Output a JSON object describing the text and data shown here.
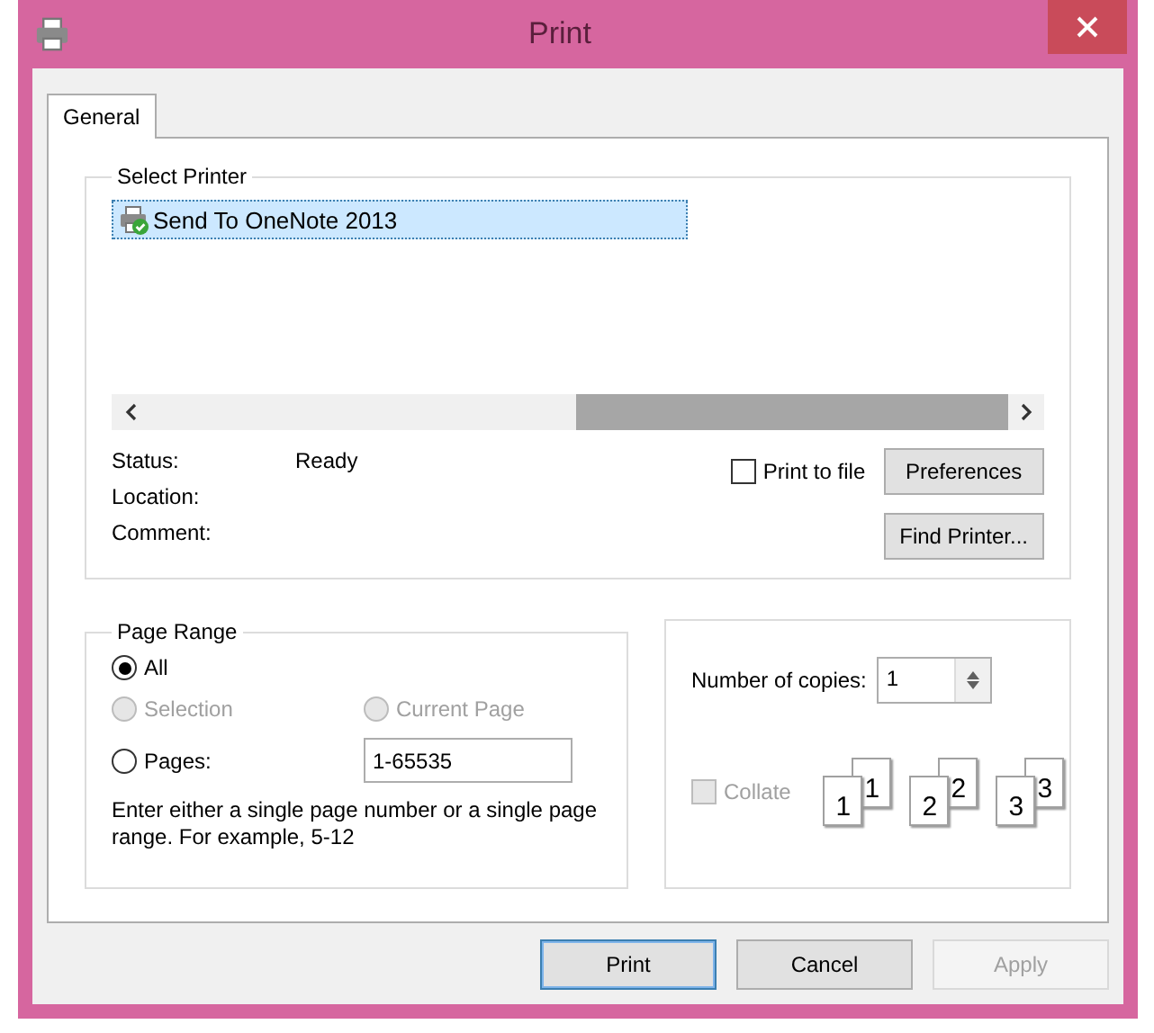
{
  "window": {
    "title": "Print"
  },
  "tabs": [
    {
      "label": "General",
      "selected": true
    }
  ],
  "select_printer": {
    "title": "Select Printer",
    "printers": [
      {
        "name": "Send To OneNote 2013",
        "selected": true
      }
    ],
    "info": [
      {
        "label": "Status:",
        "value": "Ready"
      },
      {
        "label": "Location:"
      },
      {
        "label": "Comment:"
      }
    ],
    "print_to_file": {
      "label": "Print to file",
      "checked": false
    },
    "buttons": [
      {
        "label": "Preferences"
      },
      {
        "label": "Find Printer..."
      }
    ]
  },
  "page_range": {
    "title": "Page Range",
    "options": [
      {
        "label": "All",
        "selected": true,
        "disabled": false
      },
      {
        "label": "Selection",
        "selected": false,
        "disabled": true
      },
      {
        "label": "Current Page",
        "selected": false,
        "disabled": true
      },
      {
        "label": "Pages:",
        "selected": false,
        "disabled": false
      }
    ],
    "pages_value": "1-65535",
    "hint": "Enter either a single page number or a single page range.  For example, 5-12"
  },
  "copies": {
    "label": "Number of copies:",
    "value": "1",
    "collate": {
      "label": "Collate",
      "checked": false,
      "disabled": true
    },
    "collate_pages": [
      {
        "front": "1",
        "back": "1"
      },
      {
        "front": "2",
        "back": "2"
      },
      {
        "front": "3",
        "back": "3"
      }
    ]
  },
  "footer_buttons": [
    {
      "label": "Print",
      "default": true,
      "disabled": false
    },
    {
      "label": "Cancel",
      "default": false,
      "disabled": false
    },
    {
      "label": "Apply",
      "default": false,
      "disabled": true
    }
  ]
}
